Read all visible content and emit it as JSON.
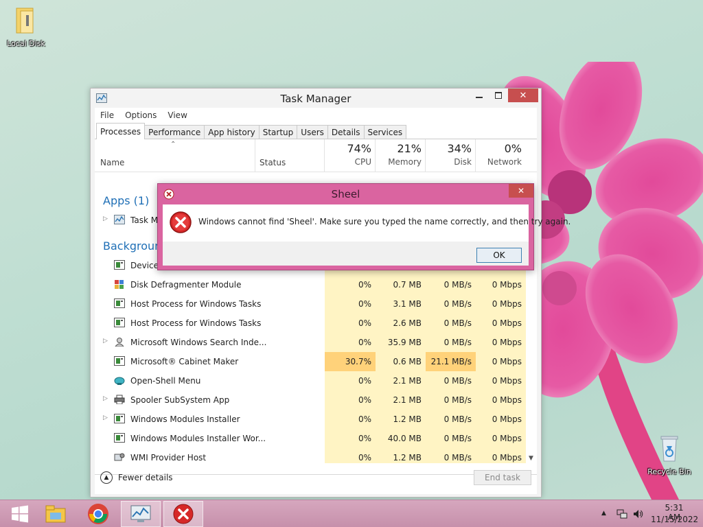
{
  "desktop": {
    "icons": [
      {
        "label": "Local Disk",
        "icon": "folder-icon"
      },
      {
        "label": "Recycle Bin",
        "icon": "recycle-bin-icon"
      }
    ]
  },
  "task_manager": {
    "title": "Task Manager",
    "menu": [
      "File",
      "Options",
      "View"
    ],
    "tabs": [
      "Processes",
      "Performance",
      "App history",
      "Startup",
      "Users",
      "Details",
      "Services"
    ],
    "active_tab": "Processes",
    "columns": {
      "name": "Name",
      "status": "Status",
      "cpu": {
        "percent": "74%",
        "label": "CPU"
      },
      "memory": {
        "percent": "21%",
        "label": "Memory"
      },
      "disk": {
        "percent": "34%",
        "label": "Disk"
      },
      "network": {
        "percent": "0%",
        "label": "Network"
      }
    },
    "groups": {
      "apps": "Apps (1)",
      "background": "Background"
    },
    "app_rows": [
      {
        "name": "Task M"
      }
    ],
    "background_rows": [
      {
        "name": "Device ",
        "expandable": false,
        "cpu": "",
        "memory": "",
        "disk": "",
        "network": "",
        "icon": "service-icon"
      },
      {
        "name": "Disk Defragmenter Module",
        "expandable": false,
        "cpu": "0%",
        "memory": "0.7 MB",
        "disk": "0 MB/s",
        "network": "0 Mbps",
        "icon": "defrag-icon"
      },
      {
        "name": "Host Process for Windows Tasks",
        "expandable": false,
        "cpu": "0%",
        "memory": "3.1 MB",
        "disk": "0 MB/s",
        "network": "0 Mbps",
        "icon": "service-icon"
      },
      {
        "name": "Host Process for Windows Tasks",
        "expandable": false,
        "cpu": "0%",
        "memory": "2.6 MB",
        "disk": "0 MB/s",
        "network": "0 Mbps",
        "icon": "service-icon"
      },
      {
        "name": "Microsoft Windows Search Inde...",
        "expandable": true,
        "cpu": "0%",
        "memory": "35.9 MB",
        "disk": "0 MB/s",
        "network": "0 Mbps",
        "icon": "search-user-icon"
      },
      {
        "name": "Microsoft® Cabinet Maker",
        "expandable": false,
        "cpu": "30.7%",
        "memory": "0.6 MB",
        "disk": "21.1 MB/s",
        "network": "0 Mbps",
        "icon": "service-icon",
        "hot": true
      },
      {
        "name": "Open-Shell Menu",
        "expandable": false,
        "cpu": "0%",
        "memory": "2.1 MB",
        "disk": "0 MB/s",
        "network": "0 Mbps",
        "icon": "shell-icon"
      },
      {
        "name": "Spooler SubSystem App",
        "expandable": true,
        "cpu": "0%",
        "memory": "2.1 MB",
        "disk": "0 MB/s",
        "network": "0 Mbps",
        "icon": "printer-icon"
      },
      {
        "name": "Windows Modules Installer",
        "expandable": true,
        "cpu": "0%",
        "memory": "1.2 MB",
        "disk": "0 MB/s",
        "network": "0 Mbps",
        "icon": "service-icon"
      },
      {
        "name": "Windows Modules Installer Wor...",
        "expandable": false,
        "cpu": "0%",
        "memory": "40.0 MB",
        "disk": "0 MB/s",
        "network": "0 Mbps",
        "icon": "service-icon"
      },
      {
        "name": "WMI Provider Host",
        "expandable": false,
        "cpu": "0%",
        "memory": "1.2 MB",
        "disk": "0 MB/s",
        "network": "0 Mbps",
        "icon": "wmi-icon"
      }
    ],
    "fewer_details": "Fewer details",
    "end_task": "End task"
  },
  "dialog": {
    "title": "Sheel",
    "message": "Windows cannot find 'Sheel'. Make sure you typed the name correctly, and then try again.",
    "ok": "OK"
  },
  "taskbar": {
    "buttons": [
      "start-icon",
      "file-explorer-icon",
      "chrome-icon",
      "task-manager-icon",
      "error-icon"
    ],
    "time": "5:31 AM",
    "date": "11/15/2022"
  },
  "colors": {
    "dialog_frame": "#da64a0",
    "taskbar": "#c690ab",
    "cpu_heat": "#fff4c4",
    "hot_cell": "#ffd27a",
    "link_blue": "#1f6fb6"
  }
}
